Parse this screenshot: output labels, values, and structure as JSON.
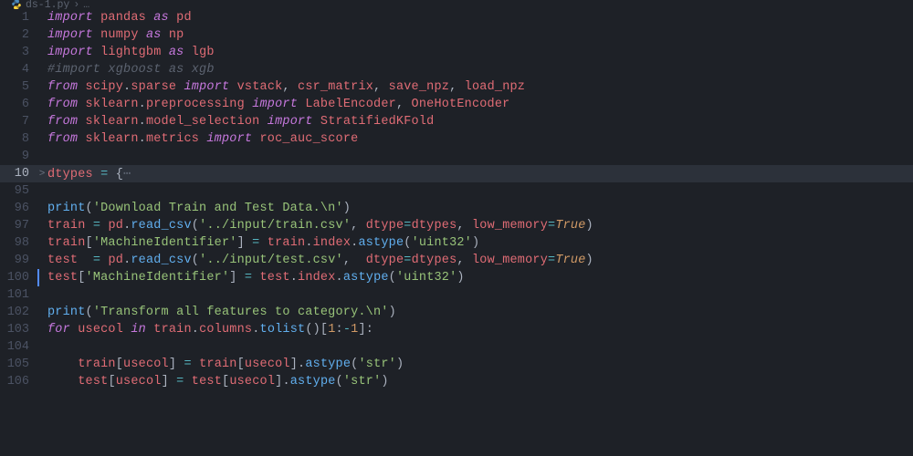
{
  "breadcrumb": {
    "file": "ds-1.py",
    "sep": "›",
    "tail": "…"
  },
  "highlight_line": 10,
  "cursor_line": 100,
  "lines": [
    {
      "n": 1,
      "indent": 0,
      "tokens": [
        [
          "kw",
          "import"
        ],
        [
          "pn",
          " "
        ],
        [
          "id",
          "pandas"
        ],
        [
          "pn",
          " "
        ],
        [
          "kw",
          "as"
        ],
        [
          "pn",
          " "
        ],
        [
          "id",
          "pd"
        ]
      ]
    },
    {
      "n": 2,
      "indent": 0,
      "tokens": [
        [
          "kw",
          "import"
        ],
        [
          "pn",
          " "
        ],
        [
          "id",
          "numpy"
        ],
        [
          "pn",
          " "
        ],
        [
          "kw",
          "as"
        ],
        [
          "pn",
          " "
        ],
        [
          "id",
          "np"
        ]
      ]
    },
    {
      "n": 3,
      "indent": 0,
      "tokens": [
        [
          "kw",
          "import"
        ],
        [
          "pn",
          " "
        ],
        [
          "id",
          "lightgbm"
        ],
        [
          "pn",
          " "
        ],
        [
          "kw",
          "as"
        ],
        [
          "pn",
          " "
        ],
        [
          "id",
          "lgb"
        ]
      ]
    },
    {
      "n": 4,
      "indent": 0,
      "tokens": [
        [
          "cm",
          "#import xgboost as xgb"
        ]
      ]
    },
    {
      "n": 5,
      "indent": 0,
      "tokens": [
        [
          "kw",
          "from"
        ],
        [
          "pn",
          " "
        ],
        [
          "id",
          "scipy"
        ],
        [
          "pn",
          "."
        ],
        [
          "id",
          "sparse"
        ],
        [
          "pn",
          " "
        ],
        [
          "kw",
          "import"
        ],
        [
          "pn",
          " "
        ],
        [
          "id",
          "vstack"
        ],
        [
          "pn",
          ", "
        ],
        [
          "id",
          "csr_matrix"
        ],
        [
          "pn",
          ", "
        ],
        [
          "id",
          "save_npz"
        ],
        [
          "pn",
          ", "
        ],
        [
          "id",
          "load_npz"
        ]
      ]
    },
    {
      "n": 6,
      "indent": 0,
      "tokens": [
        [
          "kw",
          "from"
        ],
        [
          "pn",
          " "
        ],
        [
          "id",
          "sklearn"
        ],
        [
          "pn",
          "."
        ],
        [
          "id",
          "preprocessing"
        ],
        [
          "pn",
          " "
        ],
        [
          "kw",
          "import"
        ],
        [
          "pn",
          " "
        ],
        [
          "id",
          "LabelEncoder"
        ],
        [
          "pn",
          ", "
        ],
        [
          "id",
          "OneHotEncoder"
        ]
      ]
    },
    {
      "n": 7,
      "indent": 0,
      "tokens": [
        [
          "kw",
          "from"
        ],
        [
          "pn",
          " "
        ],
        [
          "id",
          "sklearn"
        ],
        [
          "pn",
          "."
        ],
        [
          "id",
          "model_selection"
        ],
        [
          "pn",
          " "
        ],
        [
          "kw",
          "import"
        ],
        [
          "pn",
          " "
        ],
        [
          "id",
          "StratifiedKFold"
        ]
      ]
    },
    {
      "n": 8,
      "indent": 0,
      "tokens": [
        [
          "kw",
          "from"
        ],
        [
          "pn",
          " "
        ],
        [
          "id",
          "sklearn"
        ],
        [
          "pn",
          "."
        ],
        [
          "id",
          "metrics"
        ],
        [
          "pn",
          " "
        ],
        [
          "kw",
          "import"
        ],
        [
          "pn",
          " "
        ],
        [
          "id",
          "roc_auc_score"
        ]
      ]
    },
    {
      "n": 9,
      "indent": 0,
      "tokens": []
    },
    {
      "n": 10,
      "indent": 0,
      "fold": ">",
      "tokens": [
        [
          "id",
          "dtypes"
        ],
        [
          "pn",
          " "
        ],
        [
          "op",
          "="
        ],
        [
          "pn",
          " {"
        ],
        [
          "dim",
          "⋯"
        ]
      ]
    },
    {
      "n": 95,
      "indent": 0,
      "tokens": []
    },
    {
      "n": 96,
      "indent": 0,
      "tokens": [
        [
          "fn",
          "print"
        ],
        [
          "pn",
          "("
        ],
        [
          "str",
          "'Download Train and Test Data.\\n'"
        ],
        [
          "pn",
          ")"
        ]
      ]
    },
    {
      "n": 97,
      "indent": 0,
      "tokens": [
        [
          "id",
          "train"
        ],
        [
          "pn",
          " "
        ],
        [
          "op",
          "="
        ],
        [
          "pn",
          " "
        ],
        [
          "id",
          "pd"
        ],
        [
          "pn",
          "."
        ],
        [
          "fn",
          "read_csv"
        ],
        [
          "pn",
          "("
        ],
        [
          "str",
          "'../input/train.csv'"
        ],
        [
          "pn",
          ", "
        ],
        [
          "id",
          "dtype"
        ],
        [
          "op",
          "="
        ],
        [
          "id",
          "dtypes"
        ],
        [
          "pn",
          ", "
        ],
        [
          "id",
          "low_memory"
        ],
        [
          "op",
          "="
        ],
        [
          "bl",
          "True"
        ],
        [
          "pn",
          ")"
        ]
      ]
    },
    {
      "n": 98,
      "indent": 0,
      "tokens": [
        [
          "id",
          "train"
        ],
        [
          "pn",
          "["
        ],
        [
          "str",
          "'MachineIdentifier'"
        ],
        [
          "pn",
          "] "
        ],
        [
          "op",
          "="
        ],
        [
          "pn",
          " "
        ],
        [
          "id",
          "train"
        ],
        [
          "pn",
          "."
        ],
        [
          "id",
          "index"
        ],
        [
          "pn",
          "."
        ],
        [
          "fn",
          "astype"
        ],
        [
          "pn",
          "("
        ],
        [
          "str",
          "'uint32'"
        ],
        [
          "pn",
          ")"
        ]
      ]
    },
    {
      "n": 99,
      "indent": 0,
      "tokens": [
        [
          "id",
          "test"
        ],
        [
          "pn",
          "  "
        ],
        [
          "op",
          "="
        ],
        [
          "pn",
          " "
        ],
        [
          "id",
          "pd"
        ],
        [
          "pn",
          "."
        ],
        [
          "fn",
          "read_csv"
        ],
        [
          "pn",
          "("
        ],
        [
          "str",
          "'../input/test.csv'"
        ],
        [
          "pn",
          ",  "
        ],
        [
          "id",
          "dtype"
        ],
        [
          "op",
          "="
        ],
        [
          "id",
          "dtypes"
        ],
        [
          "pn",
          ", "
        ],
        [
          "id",
          "low_memory"
        ],
        [
          "op",
          "="
        ],
        [
          "bl",
          "True"
        ],
        [
          "pn",
          ")"
        ]
      ]
    },
    {
      "n": 100,
      "indent": 0,
      "tokens": [
        [
          "id",
          "test"
        ],
        [
          "pn",
          "["
        ],
        [
          "str",
          "'MachineIdentifier'"
        ],
        [
          "pn",
          "] "
        ],
        [
          "op",
          "="
        ],
        [
          "pn",
          " "
        ],
        [
          "id",
          "test"
        ],
        [
          "pn",
          "."
        ],
        [
          "id",
          "index"
        ],
        [
          "pn",
          "."
        ],
        [
          "fn",
          "astype"
        ],
        [
          "pn",
          "("
        ],
        [
          "str",
          "'uint32'"
        ],
        [
          "pn",
          ")"
        ]
      ]
    },
    {
      "n": 101,
      "indent": 0,
      "tokens": []
    },
    {
      "n": 102,
      "indent": 0,
      "tokens": [
        [
          "fn",
          "print"
        ],
        [
          "pn",
          "("
        ],
        [
          "str",
          "'Transform all features to category.\\n'"
        ],
        [
          "pn",
          ")"
        ]
      ]
    },
    {
      "n": 103,
      "indent": 0,
      "tokens": [
        [
          "kw",
          "for"
        ],
        [
          "pn",
          " "
        ],
        [
          "id",
          "usecol"
        ],
        [
          "pn",
          " "
        ],
        [
          "kw",
          "in"
        ],
        [
          "pn",
          " "
        ],
        [
          "id",
          "train"
        ],
        [
          "pn",
          "."
        ],
        [
          "id",
          "columns"
        ],
        [
          "pn",
          "."
        ],
        [
          "fn",
          "tolist"
        ],
        [
          "pn",
          "()["
        ],
        [
          "num",
          "1"
        ],
        [
          "pn",
          ":"
        ],
        [
          "op",
          "-"
        ],
        [
          "num",
          "1"
        ],
        [
          "pn",
          "]:"
        ]
      ]
    },
    {
      "n": 104,
      "indent": 0,
      "tokens": []
    },
    {
      "n": 105,
      "indent": 1,
      "tokens": [
        [
          "id",
          "train"
        ],
        [
          "pn",
          "["
        ],
        [
          "id",
          "usecol"
        ],
        [
          "pn",
          "] "
        ],
        [
          "op",
          "="
        ],
        [
          "pn",
          " "
        ],
        [
          "id",
          "train"
        ],
        [
          "pn",
          "["
        ],
        [
          "id",
          "usecol"
        ],
        [
          "pn",
          "]."
        ],
        [
          "fn",
          "astype"
        ],
        [
          "pn",
          "("
        ],
        [
          "str",
          "'str'"
        ],
        [
          "pn",
          ")"
        ]
      ]
    },
    {
      "n": 106,
      "indent": 1,
      "tokens": [
        [
          "id",
          "test"
        ],
        [
          "pn",
          "["
        ],
        [
          "id",
          "usecol"
        ],
        [
          "pn",
          "] "
        ],
        [
          "op",
          "="
        ],
        [
          "pn",
          " "
        ],
        [
          "id",
          "test"
        ],
        [
          "pn",
          "["
        ],
        [
          "id",
          "usecol"
        ],
        [
          "pn",
          "]."
        ],
        [
          "fn",
          "astype"
        ],
        [
          "pn",
          "("
        ],
        [
          "str",
          "'str'"
        ],
        [
          "pn",
          ")"
        ]
      ]
    }
  ]
}
